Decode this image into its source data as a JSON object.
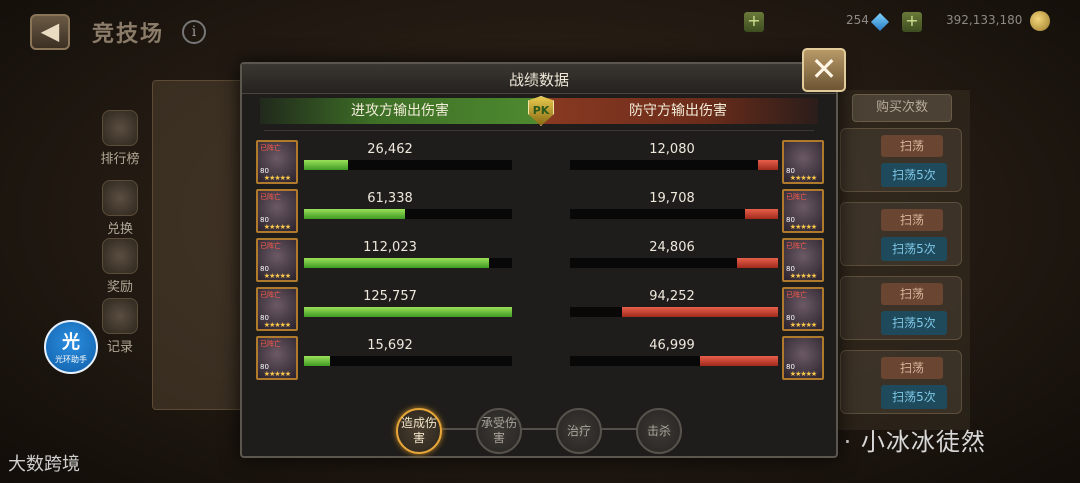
{
  "background": {
    "back_icon": "arrow-left-icon",
    "title": "竞技场",
    "info_glyph": "i",
    "gems": "254",
    "gold": "392,133,180",
    "nav": [
      "排行榜",
      "兑换",
      "奖励",
      "记录"
    ],
    "buy_label": "购买次数",
    "sweep_label": "扫荡",
    "sweep5_label": "扫荡5次",
    "assistant_glyph": "光",
    "assistant_label": "光环助手"
  },
  "watermarks": {
    "left": "大数跨境",
    "right": "公众号 · 小冰冰徒然"
  },
  "dialog": {
    "title": "战绩数据",
    "close_glyph": "✕",
    "attack_label": "进攻方输出伤害",
    "defend_label": "防守方输出伤害",
    "pk_label": "PK",
    "dead_label": "已阵亡",
    "level": "80",
    "stars": "★★★★★",
    "max_value": 125757,
    "rows": [
      {
        "attack": "26,462",
        "attack_value": 26462,
        "defend": "12,080",
        "defend_value": 12080
      },
      {
        "attack": "61,338",
        "attack_value": 61338,
        "defend": "19,708",
        "defend_value": 19708
      },
      {
        "attack": "112,023",
        "attack_value": 112023,
        "defend": "24,806",
        "defend_value": 24806
      },
      {
        "attack": "125,757",
        "attack_value": 125757,
        "defend": "94,252",
        "defend_value": 94252
      },
      {
        "attack": "15,692",
        "attack_value": 15692,
        "defend": "46,999",
        "defend_value": 46999
      }
    ],
    "tabs": [
      {
        "label": "造成伤害",
        "active": true
      },
      {
        "label": "承受伤害",
        "active": false
      },
      {
        "label": "治疗",
        "active": false
      },
      {
        "label": "击杀",
        "active": false
      }
    ]
  },
  "colors": {
    "attack_bar": "#6cc23a",
    "defend_bar": "#d8452e",
    "active_tab": "#e7a63a"
  }
}
